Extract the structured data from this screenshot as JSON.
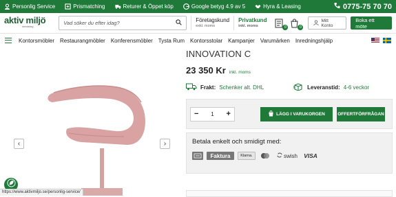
{
  "topbar": {
    "items": [
      {
        "icon": "support-icon",
        "label": "Personlig Service"
      },
      {
        "icon": "price-tag-icon",
        "label": "Prismatching"
      },
      {
        "icon": "truck-icon",
        "label": "Returer & Öppet köp"
      },
      {
        "icon": "google-icon",
        "label": "Google betyg 4.9 av 5"
      },
      {
        "icon": "handshake-icon",
        "label": "Hyra & Leasing"
      }
    ],
    "phone": "0775-75 70 70"
  },
  "header": {
    "logo_text": "aktiv miljö",
    "logo_sub": "inredning",
    "search_placeholder": "Vad söker du efter idag?",
    "company_label": "Företagskund",
    "company_sub": "exkl. moms",
    "private_label": "Privatkund",
    "private_sub": "inkl. moms",
    "wishlist_count": "0",
    "cart_count": "0",
    "account_label": "Mitt Konto",
    "book_label": "Boka ett möte"
  },
  "nav": {
    "items": [
      "Kontorsmöbler",
      "Restaurangmöbler",
      "Konferensmöbler",
      "Tysta Rum",
      "Kontorsstolar",
      "Kampanjer",
      "Varumärken",
      "Inredningshjälp"
    ]
  },
  "product": {
    "title": "INNOVATION C",
    "price": "23 350 Kr",
    "vat": "inkl. moms",
    "freight_label": "Frakt:",
    "freight_value": "Schenker alt. DHL",
    "delivery_label": "Leveranstid:",
    "delivery_value": "4-6 veckor",
    "quantity": "1",
    "add_to_cart": "LÄGG I VARUKORGEN",
    "quote": "OFFERTFÖRFRÅGAN"
  },
  "payment": {
    "title": "Betala enkelt och smidigt med:",
    "methods": [
      "Faktura",
      "Klarna.",
      "swish",
      "VISA"
    ]
  },
  "status_url": "https://www.aktivmiljo.se/personlig-service/",
  "colors": {
    "brand": "#1f7a3a",
    "product": "#d9a3a3"
  }
}
